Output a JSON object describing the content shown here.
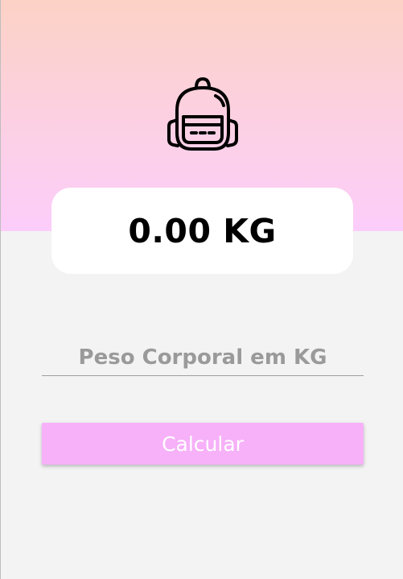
{
  "header": {
    "icon": "backpack-icon",
    "gradient_top": "#fcd2c6",
    "gradient_bottom": "#fccdfa"
  },
  "result": {
    "value": "0.00 KG"
  },
  "form": {
    "weight_placeholder": "Peso Corporal em KG",
    "weight_value": "",
    "calculate_label": "Calcular",
    "button_color": "#f6b1f8"
  }
}
